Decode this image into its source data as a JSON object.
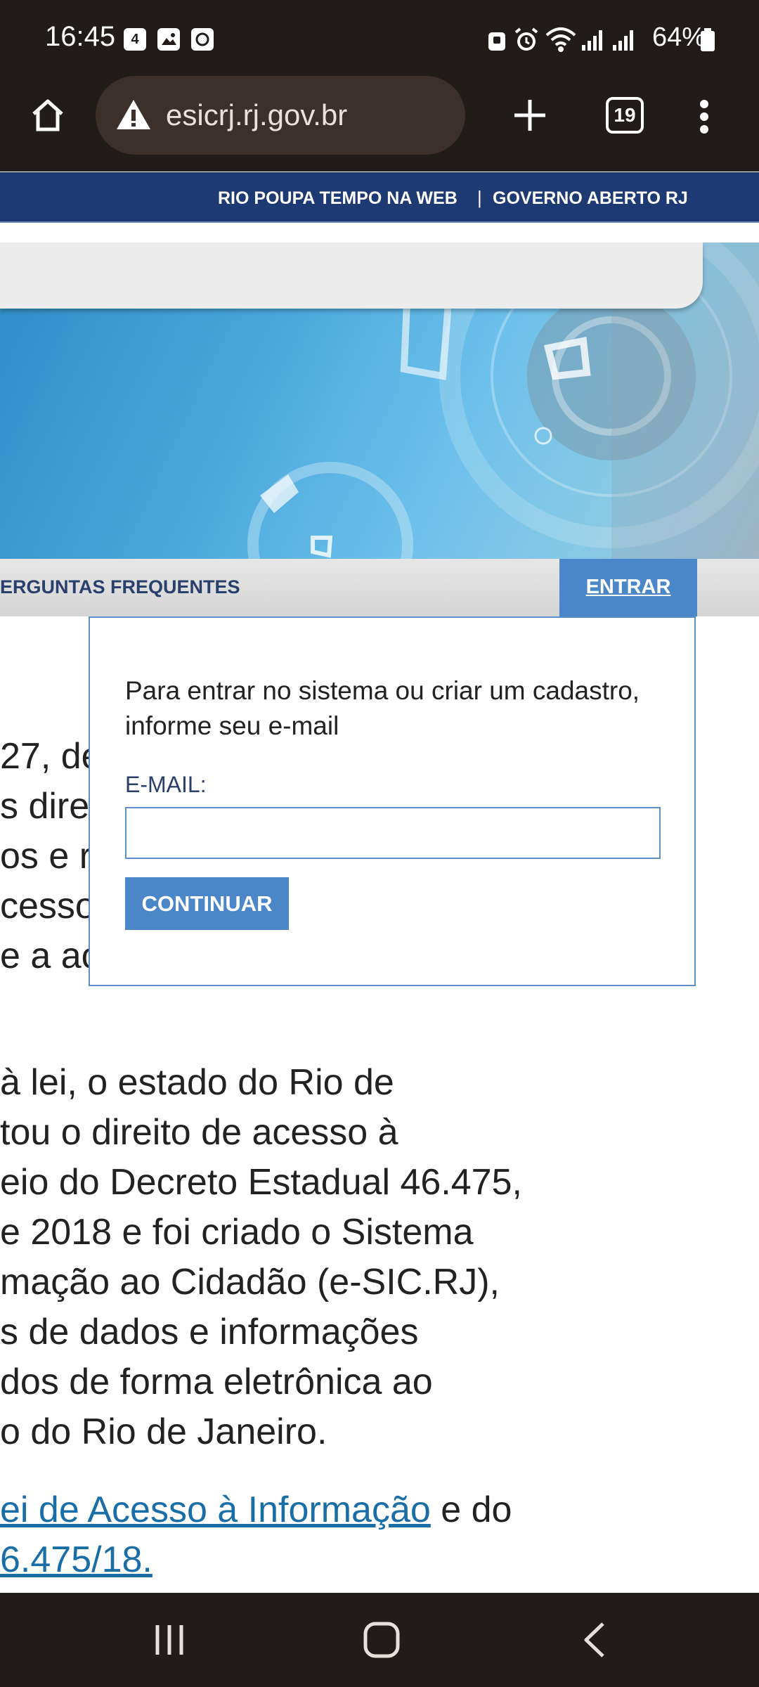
{
  "status_bar": {
    "time": "16:45",
    "notification_icons": [
      "calendar-4-icon",
      "gallery-icon",
      "clock-app-icon"
    ],
    "right_icons": [
      "lock-icon",
      "alarm-icon",
      "wifi-icon",
      "signal-icon",
      "signal-icon"
    ],
    "battery": "64%"
  },
  "browser": {
    "url": "esicrj.rj.gov.br",
    "tab_count": "19",
    "icons": [
      "home-icon",
      "warning-icon",
      "plus-icon",
      "tabs-icon",
      "more-vert-icon"
    ]
  },
  "site": {
    "top_links": [
      "RIO POUPA TEMPO NA WEB",
      "|",
      "GOVERNO ABERTO RJ"
    ],
    "nav": {
      "faq": "ERGUNTAS FREQUENTES",
      "enter": "ENTRAR"
    },
    "body_lines_top": [
      "27, de",
      "s dire",
      "os e re",
      "cesso",
      "e a ac"
    ],
    "body_lines": [
      "à lei, o estado do Rio de",
      "tou o direito de acesso à",
      "eio do Decreto Estadual 46.475,",
      "e 2018 e foi criado o Sistema",
      "mação ao Cidadão (e-SIC.RJ),",
      "s de dados e informações",
      "dos de forma eletrônica ao",
      "o do Rio de Janeiro."
    ],
    "link_line_1": "ei de Acesso à Informação",
    "link_line_1_after": " e do",
    "link_line_2": "6.475/18."
  },
  "login_popup": {
    "message": "Para entrar no sistema ou criar um cadastro, informe seu e-mail",
    "email_label": "E-MAIL:",
    "email_value": "",
    "continue_label": "CONTINUAR"
  },
  "colors": {
    "browser_chrome": "#211c19",
    "site_header": "#1e3a72",
    "accent_blue": "#4a86c8",
    "link_blue": "#1a6ea8"
  }
}
